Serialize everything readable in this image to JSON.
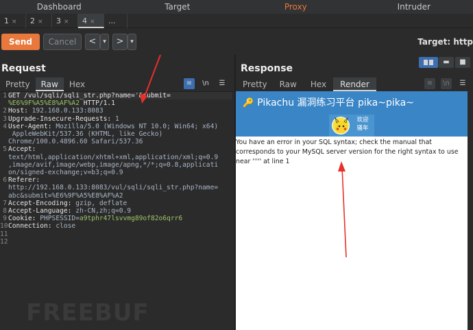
{
  "top_nav": [
    "Dashboard",
    "Target",
    "Proxy",
    "Intruder"
  ],
  "sub_tabs": [
    {
      "label": "1",
      "close": "×"
    },
    {
      "label": "2",
      "close": "×"
    },
    {
      "label": "3",
      "close": "×"
    },
    {
      "label": "4",
      "close": "×"
    }
  ],
  "sub_tab_more": "...",
  "toolbar": {
    "send": "Send",
    "cancel": "Cancel",
    "prev": "<",
    "prev_drop": "▾",
    "next": ">",
    "next_drop": "▾",
    "target": "Target: http"
  },
  "request": {
    "title": "Request",
    "tabs": [
      "Pretty",
      "Raw",
      "Hex"
    ],
    "active_tab": "Raw",
    "line_numbers": [
      "1",
      "",
      "2",
      "3",
      "4",
      "",
      "",
      "5",
      "",
      "",
      "",
      "6",
      "",
      "",
      "7",
      "8",
      "9",
      "10",
      "11",
      "12"
    ],
    "lines": [
      {
        "key": "GET /vul/sqli/sqli_str.php?name=",
        "val": "'",
        "rest": "&submit="
      },
      {
        "key": "",
        "val": "%E6%9F%A5%E8%AF%A2",
        "rest": " HTTP/1.1"
      },
      {
        "key": "Host: ",
        "val": "192.168.0.133:8083",
        "rest": ""
      },
      {
        "key": "Upgrade-Insecure-Requests: ",
        "val": "1",
        "rest": ""
      },
      {
        "key": "User-Agent: ",
        "val": "Mozilla/5.0 (Windows NT 10.0; Win64; x64)",
        "rest": ""
      },
      {
        "key": "",
        "val": " AppleWebKit/537.36 (KHTML, like Gecko)",
        "rest": ""
      },
      {
        "key": "",
        "val": "Chrome/100.0.4896.60 Safari/537.36",
        "rest": ""
      },
      {
        "key": "Accept: ",
        "val": "",
        "rest": ""
      },
      {
        "key": "",
        "val": "text/html,application/xhtml+xml,application/xml;q=0.9",
        "rest": ""
      },
      {
        "key": "",
        "val": ",image/avif,image/webp,image/apng,*/*;q=0.8,applicati",
        "rest": ""
      },
      {
        "key": "",
        "val": "on/signed-exchange;v=b3;q=0.9",
        "rest": ""
      },
      {
        "key": "Referer: ",
        "val": "",
        "rest": ""
      },
      {
        "key": "",
        "val": "http://192.168.0.133:8083/vul/sqli/sqli_str.php?name=",
        "rest": ""
      },
      {
        "key": "",
        "val": "abc&submit=%E6%9F%A5%E8%AF%A2",
        "rest": ""
      },
      {
        "key": "Accept-Encoding: ",
        "val": "gzip, deflate",
        "rest": ""
      },
      {
        "key": "Accept-Language: ",
        "val": "zh-CN,zh;q=0.9",
        "rest": ""
      },
      {
        "key": "Cookie: ",
        "val": "PHPSESSID=",
        "rest": "a9tphr47lsvvmg89of82o6qrr6"
      },
      {
        "key": "Connection: ",
        "val": "close",
        "rest": ""
      },
      {
        "key": "",
        "val": "",
        "rest": ""
      },
      {
        "key": "",
        "val": "",
        "rest": ""
      }
    ]
  },
  "response": {
    "title": "Response",
    "tabs": [
      "Pretty",
      "Raw",
      "Hex",
      "Render"
    ],
    "active_tab": "Render",
    "render": {
      "header": "Pikachu 漏洞练习平台 pika~pika~",
      "welcome_line1": "欢迎",
      "welcome_line2": "骚年",
      "error": "You have an error in your SQL syntax; check the manual that corresponds to your MySQL server version for the right syntax to use near ''''' at line 1"
    }
  },
  "watermark": "FREEBUF",
  "colors": {
    "accent": "#e8783c",
    "arrow": "#e8302a",
    "pika_blue": "#3a85c6"
  }
}
